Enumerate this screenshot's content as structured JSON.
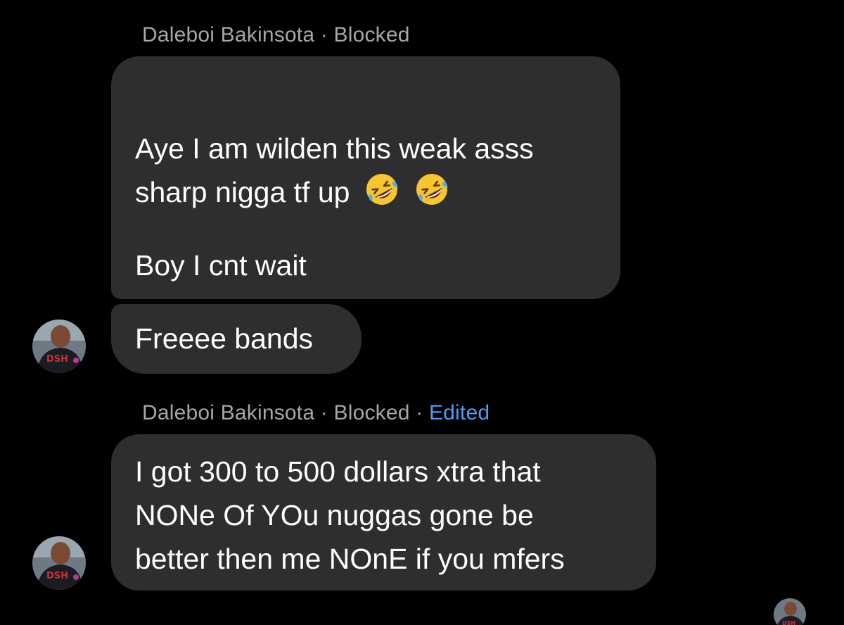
{
  "thread": {
    "group1": {
      "sender": "Daleboi Bakinsota",
      "separator": "·",
      "status": "Blocked",
      "message1": {
        "line1": "Aye I am wilden this weak asss",
        "line2": "sharp nigga tf up",
        "emoji": [
          "rolling-on-floor-laughing",
          "rolling-on-floor-laughing"
        ],
        "line3": "Boy I cnt wait"
      },
      "message2": "Freeee bands"
    },
    "group2": {
      "sender": "Daleboi Bakinsota",
      "separator": "·",
      "status": "Blocked",
      "edited": "Edited",
      "message": {
        "line1": "I got 300 to 500 dollars xtra that",
        "line2": "NONe Of YOu nuggas gone be",
        "line3": "better then me NOnE if you mfers"
      }
    }
  },
  "colors": {
    "background": "#000000",
    "bubble": "#2e2e30",
    "meta_text": "#a6a6ab",
    "edited_link": "#4a9ff5"
  }
}
